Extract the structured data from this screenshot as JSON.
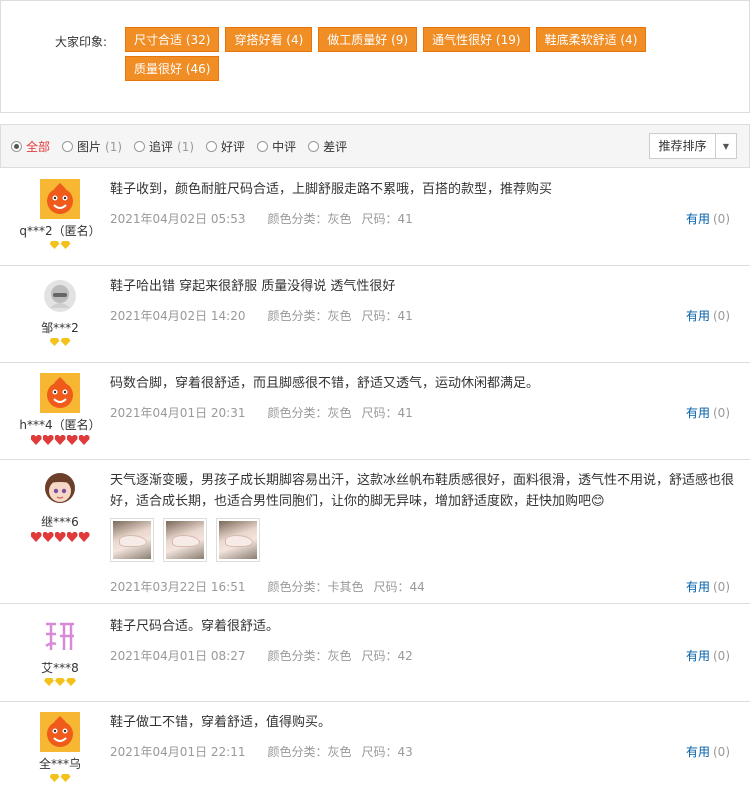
{
  "impressions": {
    "label": "大家印象:",
    "tags": [
      "尺寸合适 (32)",
      "穿搭好看 (4)",
      "做工质量好 (9)",
      "通气性很好 (19)",
      "鞋底柔软舒适 (4)",
      "质量很好 (46)"
    ]
  },
  "filters": {
    "items": [
      {
        "label": "全部",
        "count": "",
        "active": true
      },
      {
        "label": "图片",
        "count": "(1)",
        "active": false
      },
      {
        "label": "追评",
        "count": "(1)",
        "active": false
      },
      {
        "label": "好评",
        "count": "",
        "active": false
      },
      {
        "label": "中评",
        "count": "",
        "active": false
      },
      {
        "label": "差评",
        "count": "",
        "active": false
      }
    ],
    "sort_label": "推荐排序"
  },
  "reviews": [
    {
      "user": "q***2（匿名）",
      "avatar": "orange-mascot-avatar-icon",
      "level": "gem",
      "level_count": 2,
      "text": "鞋子收到，颜色耐脏尺码合适，上脚舒服走路不累哦，百搭的款型，推荐购买",
      "date": "2021年04月02日 05:53",
      "color": "颜色分类：灰色",
      "size": "尺码：41",
      "useful": "有用",
      "useful_count": "(0)"
    },
    {
      "user": "邹***2",
      "avatar": "grey-default-avatar-icon",
      "level": "gem",
      "level_count": 2,
      "text": "鞋子哈出错 穿起来很舒服 质量没得说 透气性很好",
      "date": "2021年04月02日 14:20",
      "color": "颜色分类：灰色",
      "size": "尺码：41",
      "useful": "有用",
      "useful_count": "(0)"
    },
    {
      "user": "h***4（匿名）",
      "avatar": "orange-mascot-avatar-icon",
      "level": "heart",
      "level_count": 5,
      "text": "码数合脚，穿着很舒适，而且脚感很不错，舒适又透气，运动休闲都满足。",
      "date": "2021年04月01日 20:31",
      "color": "颜色分类：灰色",
      "size": "尺码：41",
      "useful": "有用",
      "useful_count": "(0)"
    },
    {
      "user": "继***6",
      "avatar": "cartoon-girl-avatar-icon",
      "level": "heart",
      "level_count": 5,
      "text": "天气逐渐变暖，男孩子成长期脚容易出汗，这款冰丝帆布鞋质感很好，面料很滑，透气性不用说，舒适感也很好，适合成长期，也适合男性同胞们，让你的脚无异味，增加舒适度欧，赶快加购吧😊",
      "date": "2021年03月22日 16:51",
      "color": "颜色分类：卡其色",
      "size": "尺码：44",
      "useful": "有用",
      "useful_count": "(0)"
    },
    {
      "user": "艾***8",
      "avatar": "pink-character-avatar-icon",
      "level": "gem",
      "level_count": 3,
      "text": "鞋子尺码合适。穿着很舒适。",
      "date": "2021年04月01日 08:27",
      "color": "颜色分类：灰色",
      "size": "尺码：42",
      "useful": "有用",
      "useful_count": "(0)"
    },
    {
      "user": "全***乌",
      "avatar": "orange-mascot-avatar-icon",
      "level": "gem",
      "level_count": 2,
      "text": "鞋子做工不错，穿着舒适，值得购买。",
      "date": "2021年04月01日 22:11",
      "color": "颜色分类：灰色",
      "size": "尺码：43",
      "useful": "有用",
      "useful_count": "(0)"
    }
  ],
  "colors": {
    "tag_bg": "#f08d25",
    "link": "#005ea7",
    "active_filter": "#e4393c",
    "gem": "#f4c21b",
    "heart": "#e03a3a"
  }
}
